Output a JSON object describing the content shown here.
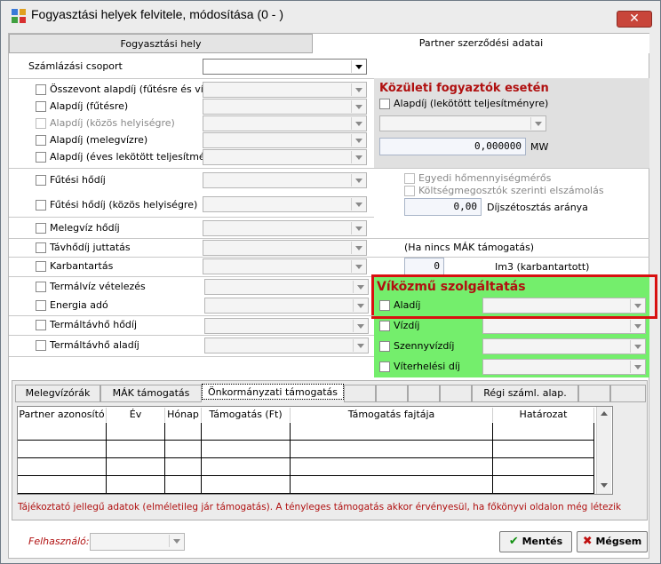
{
  "window": {
    "title": "Fogyasztási helyek felvitele, módosítása (0 - )"
  },
  "tabs": {
    "tab1": "Fogyasztási hely",
    "tab2": "Partner szerződési adatai"
  },
  "left": {
    "szamlazasi_csoport": "Számlázási csoport",
    "items": [
      "Összevont alapdíj (fűtésre és vízre)",
      "Alapdíj (fűtésre)",
      "Alapdíj (közös helyiségre)",
      "Alapdíj (melegvízre)",
      "Alapdíj (éves lekötött teljesítményre)",
      "Fűtési hődíj",
      "Fűtési hődíj (közös helyiségre)",
      "Melegvíz hődíj",
      "Távhődíj juttatás",
      "Karbantartás",
      "Termálvíz vételezés",
      "Energia adó",
      "Termáltávhő hődíj",
      "Termáltávhő aladíj"
    ]
  },
  "kozuleti": {
    "title": "Közületi fogyaztók esetén",
    "alapdij": "Alapdíj (lekötött teljesítményre)",
    "value": "0,000000",
    "unit": "MW",
    "egyedi": "Egyedi hőmennyiségmérős",
    "koltseg": "Költségmegosztók szerinti elszámolás",
    "dij_value": "0,00",
    "dij_label": "Díjszétosztás aránya",
    "mak_note": "(Ha nincs MÁK támogatás)",
    "im3_value": "0",
    "im3_label": "Im3 (karbantartott)"
  },
  "vizkozmu": {
    "title": "Víközmű szolgáltatás",
    "items": [
      "Aladíj",
      "Vízdíj",
      "Szennyvízdíj",
      "Víterhelési díj"
    ]
  },
  "bottom_tabs": [
    "Melegvízórák",
    "MÁK támogatás",
    "Önkormányzati támogatás",
    "Régi száml. alap."
  ],
  "grid": {
    "headers": [
      "Partner azonosító",
      "Év",
      "Hónap",
      "Támogatás (Ft)",
      "Támogatás fajtája",
      "Határozat"
    ]
  },
  "info_text": "Tájékoztató jellegű adatok (elméletileg jár támogatás). A tényleges támogatás akkor érvényesül, ha főkönyvi oldalon még létezik",
  "footer": {
    "user_label": "Felhasználó:",
    "save": "Mentés",
    "cancel": "Mégsem"
  },
  "colors": {
    "accent_green": "#74ee6c",
    "red_title": "#b01010",
    "highlight_red": "#d81010"
  }
}
